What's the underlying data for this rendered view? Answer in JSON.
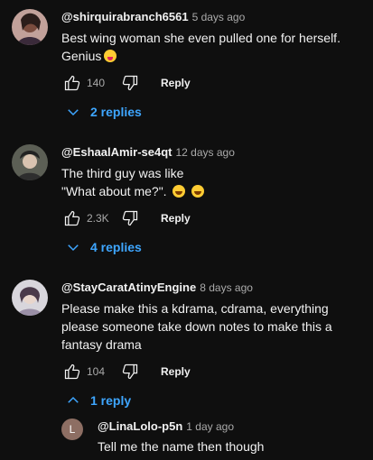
{
  "comments": [
    {
      "author": "@shirquirabranch6561",
      "time": "5 days ago",
      "text": "Best wing woman she even pulled one for herself. Genius",
      "likes": "140",
      "reply_label": "Reply",
      "replies_toggle": "2 replies",
      "emoji": "😛"
    },
    {
      "author": "@EshaalAmir-se4qt",
      "time": "12 days ago",
      "text_line1": "The third guy was like",
      "text_line2": "\"What about me?\".",
      "likes": "2.3K",
      "reply_label": "Reply",
      "replies_toggle": "4 replies",
      "emoji": "😂 😂"
    },
    {
      "author": "@StayCaratAtinyEngine",
      "time": "8 days ago",
      "text": "Please make this a kdrama, cdrama, everything please someone take down notes to make this a fantasy drama",
      "likes": "104",
      "reply_label": "Reply",
      "replies_toggle": "1 reply"
    }
  ],
  "reply": {
    "avatar_letter": "L",
    "author": "@LinaLolo-p5n",
    "time": "1 day ago",
    "text": "Tell me the name then though"
  },
  "colors": {
    "background": "#0f0f0f",
    "link": "#3ea6ff",
    "muted": "#aaaaaa"
  },
  "icons": [
    "like-icon",
    "dislike-icon",
    "chevron-down-icon",
    "chevron-up-icon"
  ]
}
